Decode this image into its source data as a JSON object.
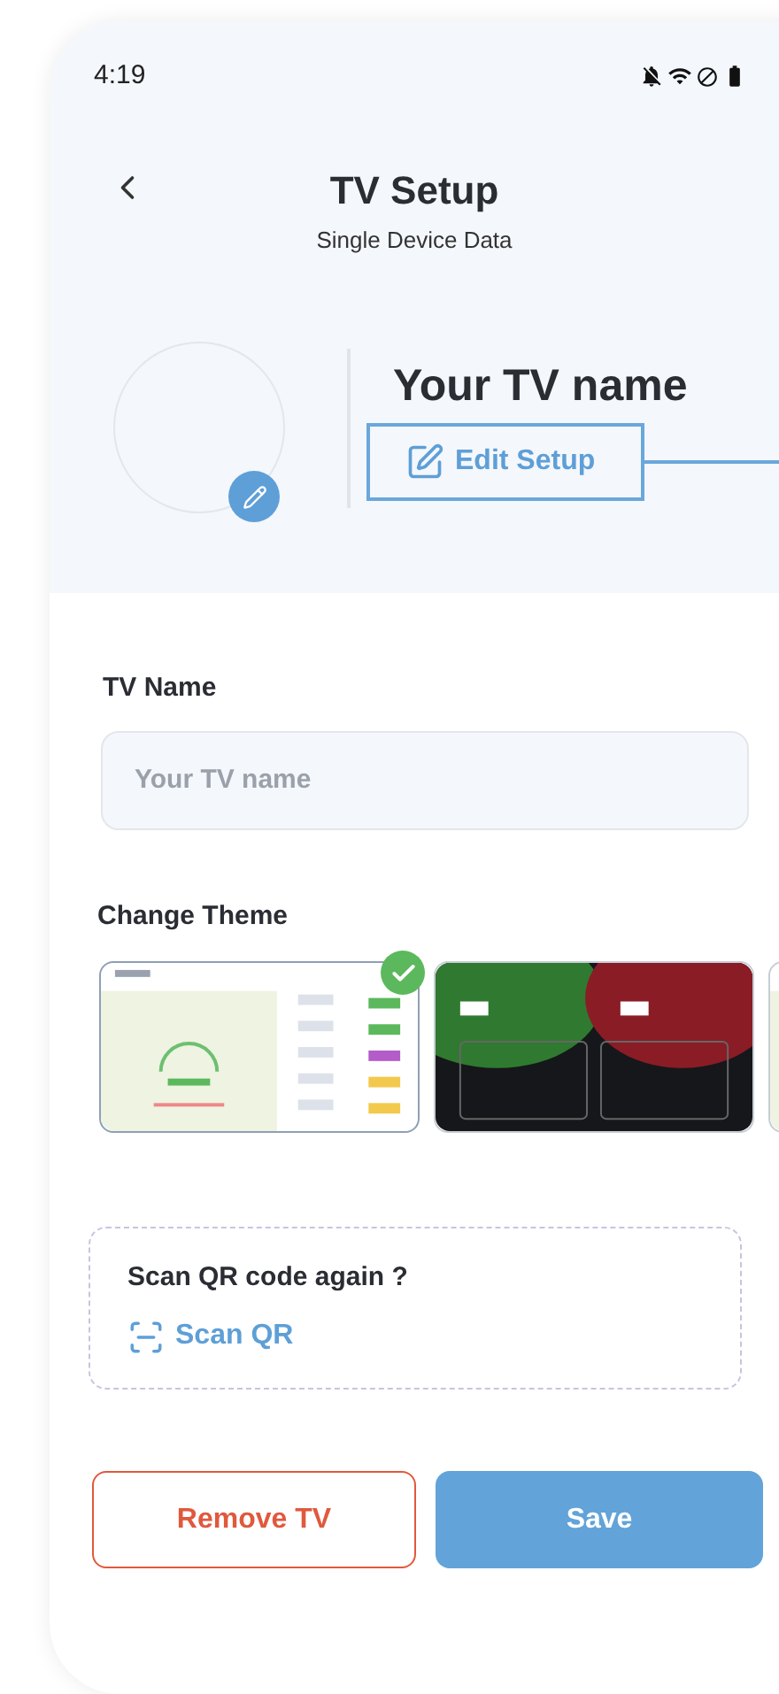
{
  "status_bar": {
    "time": "4:19"
  },
  "header": {
    "title": "TV Setup",
    "subtitle": "Single Device Data"
  },
  "device": {
    "name": "Your TV name",
    "edit_button": "Edit Setup"
  },
  "tv_name": {
    "label": "TV Name",
    "placeholder": "Your TV name"
  },
  "theme": {
    "label": "Change Theme",
    "options": [
      {
        "kind": "light",
        "selected": true
      },
      {
        "kind": "dark",
        "selected": false
      },
      {
        "kind": "light",
        "selected": false
      }
    ]
  },
  "qr_card": {
    "question": "Scan QR code again ?",
    "link": "Scan QR"
  },
  "buttons": {
    "remove": "Remove TV",
    "save": "Save"
  }
}
